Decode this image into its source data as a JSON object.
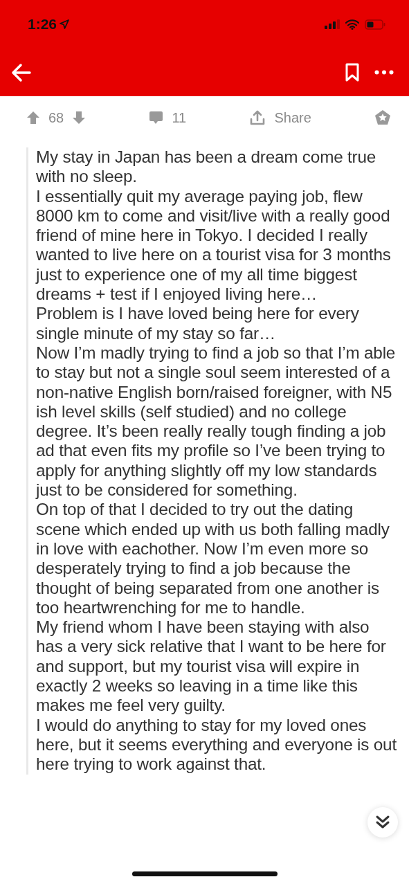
{
  "status_bar": {
    "time": "1:26"
  },
  "actions": {
    "score": "68",
    "comments": "11",
    "share": "Share"
  },
  "post": {
    "paragraphs": [
      "My stay in Japan has been a dream come true with no sleep.",
      "I essentially quit my average paying job, flew 8000 km to come and visit/live with a really good friend of mine here in Tokyo. I decided I really wanted to live here on a tourist visa for 3 months just to experience one of my all time biggest dreams + test if I enjoyed living here…",
      "Problem is I have loved being here for every single minute of my stay so far…",
      "Now I’m madly trying to find a job so that I’m able to stay but not a single soul seem interested of a non-native English born/raised foreigner, with N5 ish level skills (self studied) and no college degree. It’s been really really tough finding a job ad that even fits my profile so I’ve been trying to apply for anything slightly off my low standards just to be considered for something.",
      "On top of that I decided to try out the dating scene which ended up with us both falling madly in love with eachother. Now I’m even more so desperately trying to find a job because the thought of being separated from one another is too heartwrenching for me to handle.",
      "My friend whom I have been staying with also has a very sick relative that I want to be here for and support, but my tourist visa will expire in exactly 2 weeks so leaving in a time like this makes me feel very guilty.",
      "I would do anything to stay for my loved ones here, but it seems everything and everyone is out here trying to work against that."
    ]
  }
}
